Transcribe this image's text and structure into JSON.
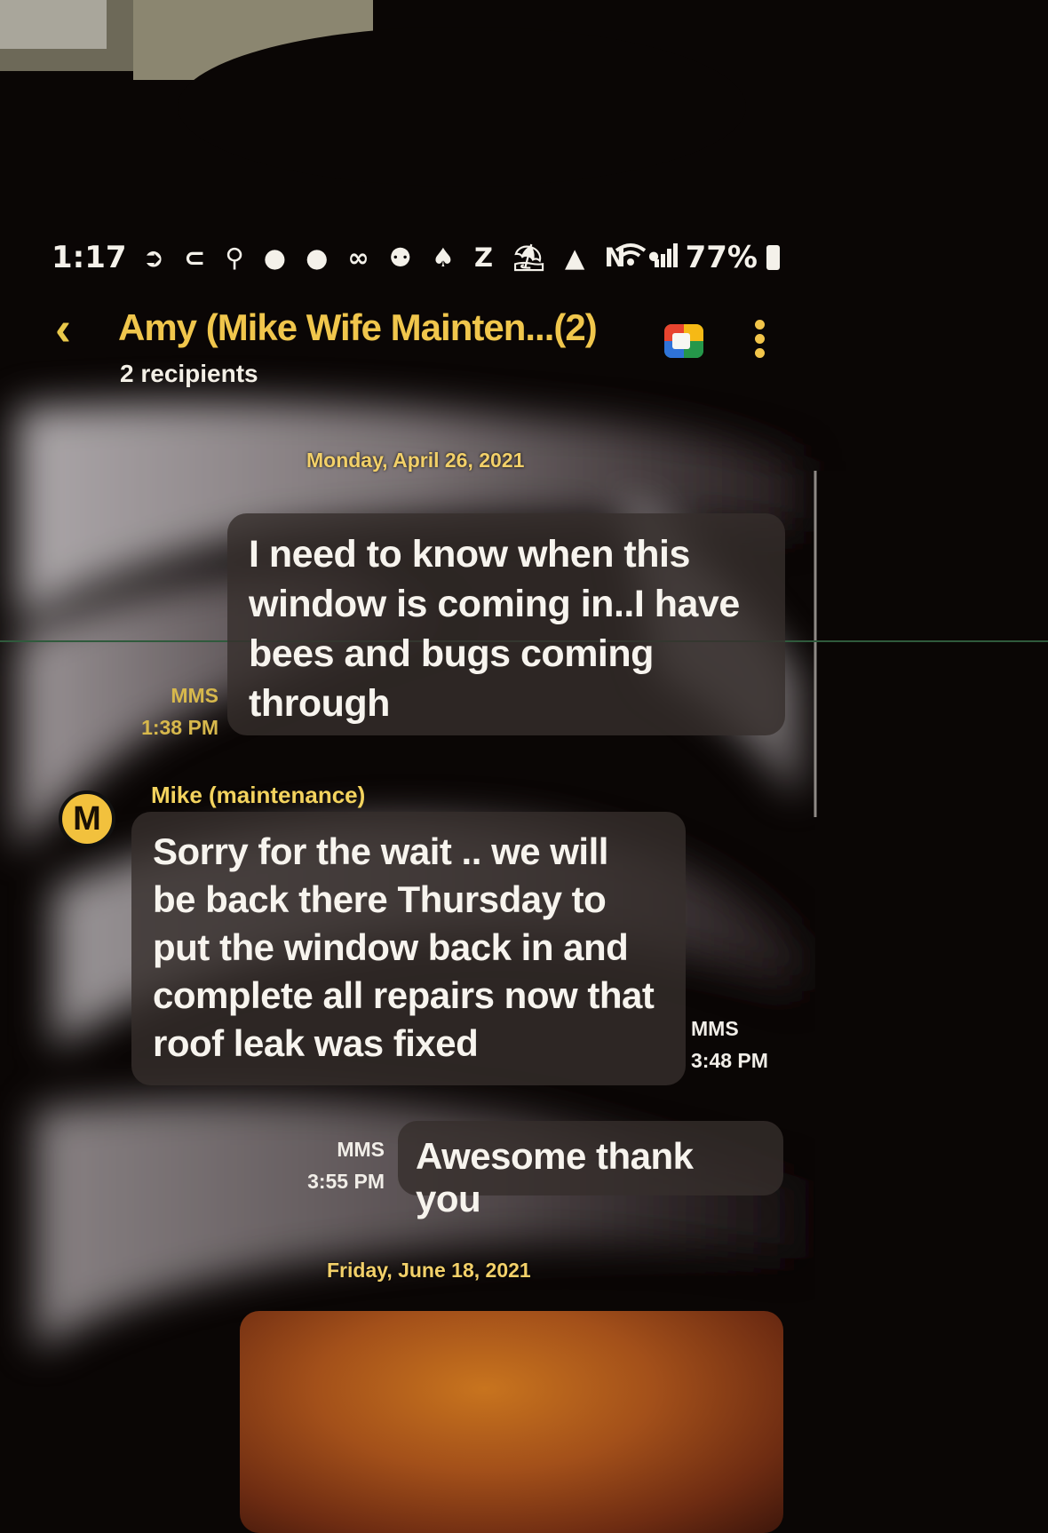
{
  "status_bar": {
    "time": "1:17",
    "notification_icons": "➲ ⊂ ⚲ ● ● ∞ ⚉ ♠ Z ⛱ ▲ N •",
    "wifi_icon": "wifi-icon",
    "signal_icon": "signal-icon",
    "battery_percent": "77%"
  },
  "header": {
    "back_icon": "‹",
    "title": "Amy (Mike Wife Mainten...(2)",
    "subtitle": "2 recipients"
  },
  "conversation": {
    "date_1": "Monday, April 26, 2021",
    "messages": [
      {
        "direction": "outgoing",
        "lines": [
          "I need to know when this",
          "window is coming in..I have",
          "bees and bugs coming",
          "through"
        ],
        "type": "MMS",
        "time": "1:38 PM"
      },
      {
        "direction": "incoming",
        "sender_initial": "M",
        "sender": "Mike (maintenance)",
        "lines": [
          "Sorry for the wait .. we will",
          "be back there Thursday to",
          "put the window back in and",
          "complete all repairs now that",
          "roof leak was fixed"
        ],
        "type": "MMS",
        "time": "3:48 PM"
      },
      {
        "direction": "outgoing",
        "lines": [
          "Awesome thank you"
        ],
        "type": "MMS",
        "time": "3:55 PM"
      }
    ],
    "date_2": "Friday, June 18, 2021"
  },
  "colors": {
    "accent": "#f0c64c",
    "bubble": "#362e2c",
    "background": "#0a0605"
  }
}
